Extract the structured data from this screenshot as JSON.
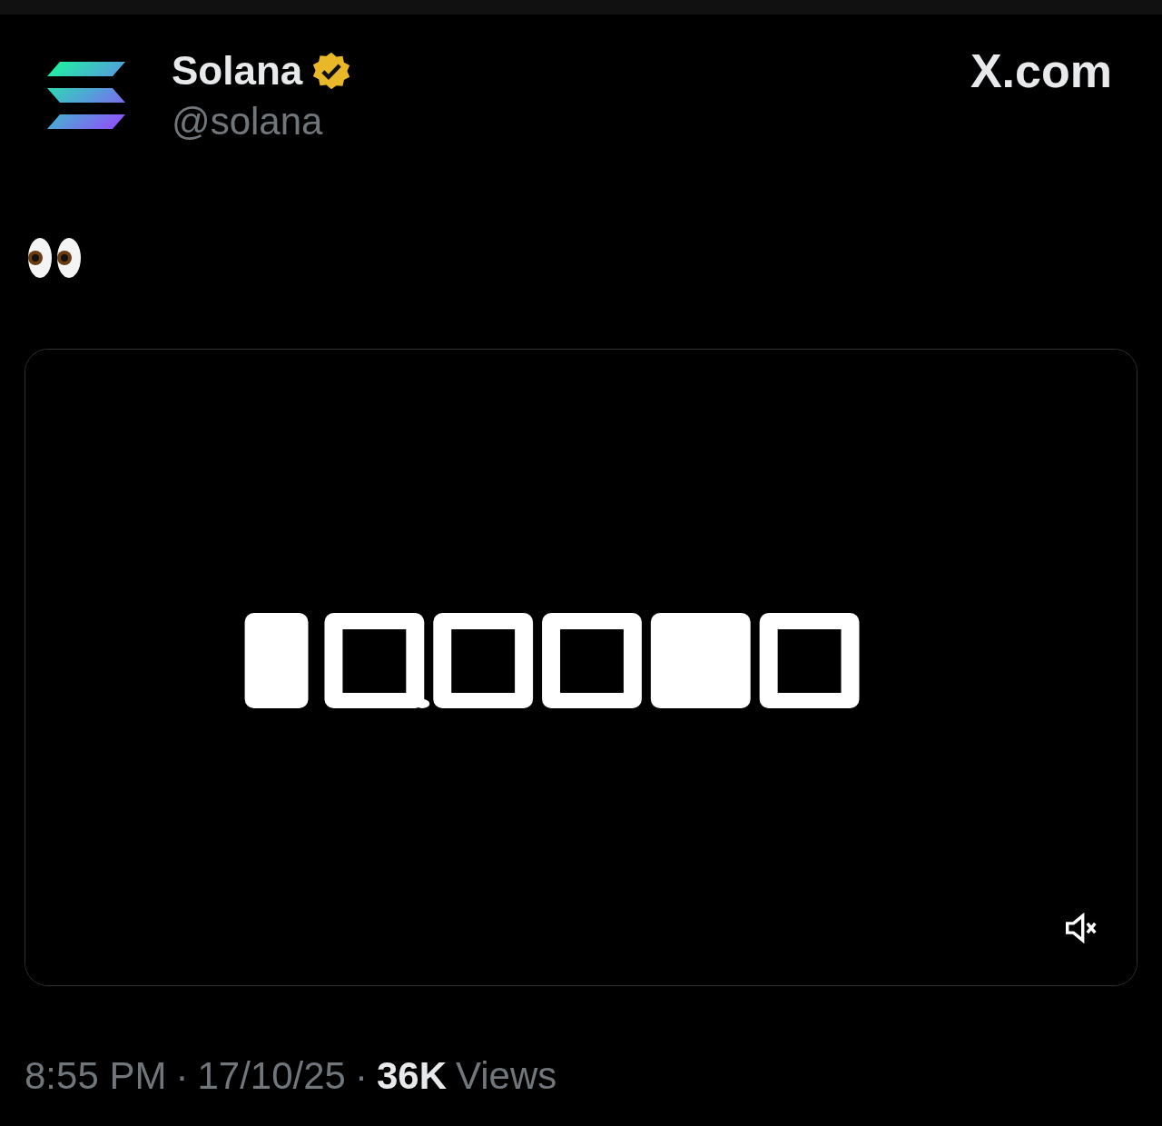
{
  "author": {
    "name": "Solana",
    "verified": true,
    "handle": "@solana"
  },
  "site": "X.com",
  "media": {
    "kind": "picture",
    "muted": true
  },
  "meta": {
    "time": "8:55 PM",
    "separators": [
      "·",
      "·"
    ],
    "date": "17/10/25",
    "views_count": "36K",
    "views_label": "Views"
  }
}
